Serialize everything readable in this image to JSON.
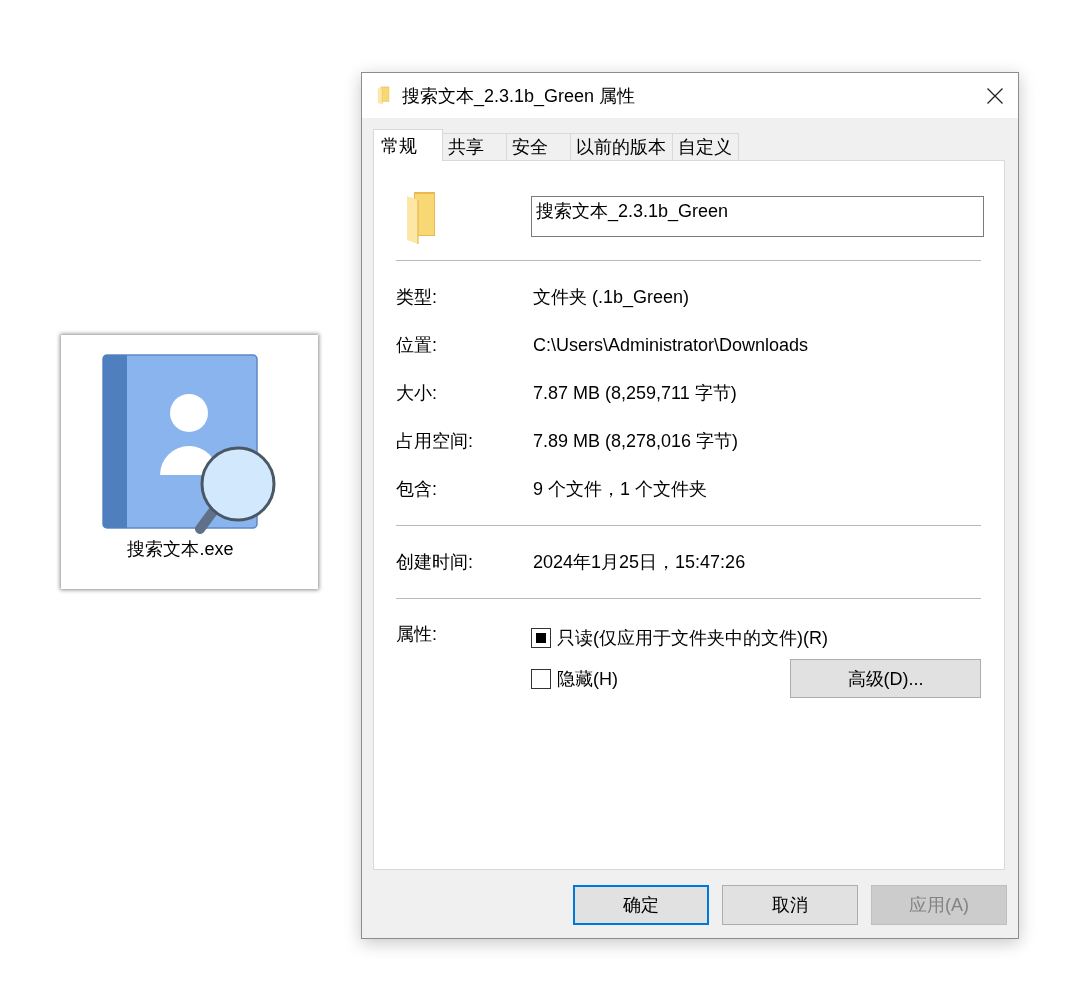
{
  "file_icon": {
    "label": "搜索文本.exe"
  },
  "window": {
    "title": "搜索文本_2.3.1b_Green 属性"
  },
  "tabs": [
    {
      "label": "常规",
      "selected": true
    },
    {
      "label": "共享",
      "selected": false
    },
    {
      "label": "安全",
      "selected": false
    },
    {
      "label": "以前的版本",
      "selected": false
    },
    {
      "label": "自定义",
      "selected": false
    }
  ],
  "general": {
    "name_field": {
      "value": "搜索文本_2.3.1b_Green"
    },
    "sections": [
      {
        "rows": [
          {
            "label": "类型:",
            "value": "文件夹 (.1b_Green)"
          },
          {
            "label": "位置:",
            "value": "C:\\Users\\Administrator\\Downloads"
          },
          {
            "label": "大小:",
            "value": "7.87 MB (8,259,711 字节)"
          },
          {
            "label": "占用空间:",
            "value": "7.89 MB (8,278,016 字节)"
          },
          {
            "label": "包含:",
            "value": "9 个文件，1 个文件夹"
          }
        ]
      },
      {
        "rows": [
          {
            "label": "创建时间:",
            "value": "2024年1月25日，15:47:26"
          }
        ]
      }
    ],
    "attributes": {
      "label": "属性:",
      "options": [
        {
          "label": "只读(仅应用于文件夹中的文件)(R)",
          "checked": false,
          "indeterminate": true
        },
        {
          "label": "隐藏(H)",
          "checked": false,
          "indeterminate": false
        }
      ],
      "advanced_button": "高级(D)..."
    }
  },
  "buttons": [
    {
      "label": "确定",
      "default": true,
      "disabled": false
    },
    {
      "label": "取消",
      "default": false,
      "disabled": false
    },
    {
      "label": "应用(A)",
      "default": false,
      "disabled": true
    }
  ]
}
